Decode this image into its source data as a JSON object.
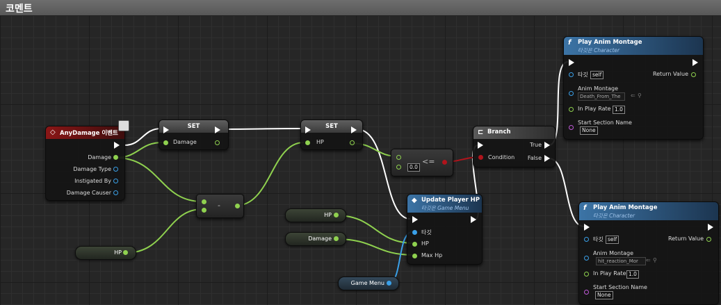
{
  "comment": {
    "title": "코멘트"
  },
  "event_node": {
    "title": "AnyDamage 이벤트",
    "outputs": [
      "Damage",
      "Damage Type",
      "Instigated By",
      "Damage Causer"
    ]
  },
  "set_node_1": {
    "title": "SET",
    "pin": "Damage"
  },
  "set_node_2": {
    "title": "SET",
    "pin": "HP"
  },
  "subtract_node": {
    "symbol": "-"
  },
  "compare_node": {
    "symbol": "<=",
    "value": "0.0"
  },
  "branch_node": {
    "title": "Branch",
    "true_label": "True",
    "false_label": "False",
    "condition_label": "Condition"
  },
  "play_montage_1": {
    "title": "Play Anim Montage",
    "subtitle": "타깃은 Character",
    "target_label": "타깃",
    "target_value": "self",
    "return_label": "Return Value",
    "montage_label": "Anim Montage",
    "montage_value": "Death_From_The",
    "rate_label": "In Play Rate",
    "rate_value": "1.0",
    "section_label": "Start Section Name",
    "section_value": "None"
  },
  "play_montage_2": {
    "title": "Play Anim Montage",
    "subtitle": "타깃은 Character",
    "target_label": "타깃",
    "target_value": "self",
    "return_label": "Return Value",
    "montage_label": "Anim Montage",
    "montage_value": "hit_reaction_Mor",
    "rate_label": "In Play Rate",
    "rate_value": "1.0",
    "section_label": "Start Section Name",
    "section_value": "None"
  },
  "update_hp_node": {
    "title": "Update Player HP",
    "subtitle": "타깃은 Game Menu",
    "inputs": [
      "타깃",
      "HP",
      "Max Hp"
    ]
  },
  "variables": {
    "hp_left": "HP",
    "hp_mid": "HP",
    "damage_mid": "Damage",
    "game_menu": "Game Menu"
  },
  "colors": {
    "exec": "#ffffff",
    "float_pin": "#8fd14f",
    "object_pin": "#3aa0e8",
    "bool_pin": "#b0141c",
    "name_pin": "#c05ad8",
    "event_header": "#8a1616",
    "function_header": "#3c74a6"
  },
  "icons": {
    "event": "diamond-icon",
    "function": "function-f-icon",
    "branch": "branch-icon",
    "browse": "arrow-left-icon",
    "search": "magnifier-icon"
  }
}
